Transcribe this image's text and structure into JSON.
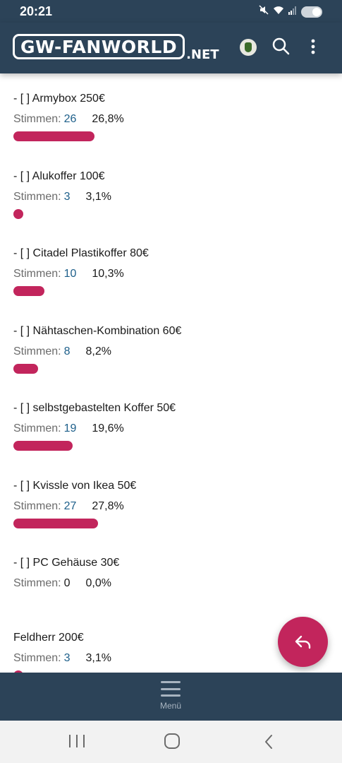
{
  "status_bar": {
    "time": "20:21",
    "icons": [
      "mute-icon",
      "wifi-icon",
      "signal-icon",
      "battery-icon"
    ]
  },
  "header": {
    "logo_main": "GW-FANWORLD",
    "logo_suffix": ".NET",
    "icons": [
      "avatar",
      "search-icon",
      "more-vert-icon"
    ]
  },
  "poll": {
    "stimmen_label": "Stimmen:",
    "options": [
      {
        "label": "- [ ] Armybox 250€",
        "count": "26",
        "percent": "26,8%",
        "fraction": 0.268
      },
      {
        "label": "- [ ] Alukoffer 100€",
        "count": "3",
        "percent": "3,1%",
        "fraction": 0.031
      },
      {
        "label": "- [ ] Citadel Plastikoffer 80€",
        "count": "10",
        "percent": "10,3%",
        "fraction": 0.103
      },
      {
        "label": "- [ ] Nähtaschen-Kombination 60€",
        "count": "8",
        "percent": "8,2%",
        "fraction": 0.082
      },
      {
        "label": "- [ ] selbstgebastelten Koffer 50€",
        "count": "19",
        "percent": "19,6%",
        "fraction": 0.196
      },
      {
        "label": "- [ ] Kvissle von Ikea 50€",
        "count": "27",
        "percent": "27,8%",
        "fraction": 0.278
      },
      {
        "label": "- [ ] PC Gehäuse 30€",
        "count": "0",
        "percent": "0,0%",
        "fraction": 0.0
      },
      {
        "label": "Feldherr 200€",
        "count": "3",
        "percent": "3,1%",
        "fraction": 0.031
      }
    ]
  },
  "fab": {
    "icon": "reply-icon"
  },
  "bottom_menu": {
    "label": "Menü",
    "icon": "hamburger-icon"
  },
  "nav_bar": {
    "icons": [
      "recent-apps-icon",
      "home-icon",
      "back-icon"
    ]
  },
  "colors": {
    "header_bg": "#2c4358",
    "accent": "#c2255c",
    "count_link": "#1d5f8a"
  }
}
